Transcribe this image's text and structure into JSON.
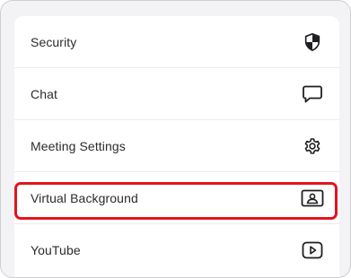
{
  "settings_menu": {
    "items": [
      {
        "label": "Security",
        "icon": "shield-icon"
      },
      {
        "label": "Chat",
        "icon": "chat-bubble-icon"
      },
      {
        "label": "Meeting Settings",
        "icon": "gear-icon"
      },
      {
        "label": "Virtual Background",
        "icon": "portrait-frame-icon",
        "highlighted": true
      },
      {
        "label": "YouTube",
        "icon": "play-button-icon"
      }
    ],
    "highlight_color": "#e3141d"
  }
}
